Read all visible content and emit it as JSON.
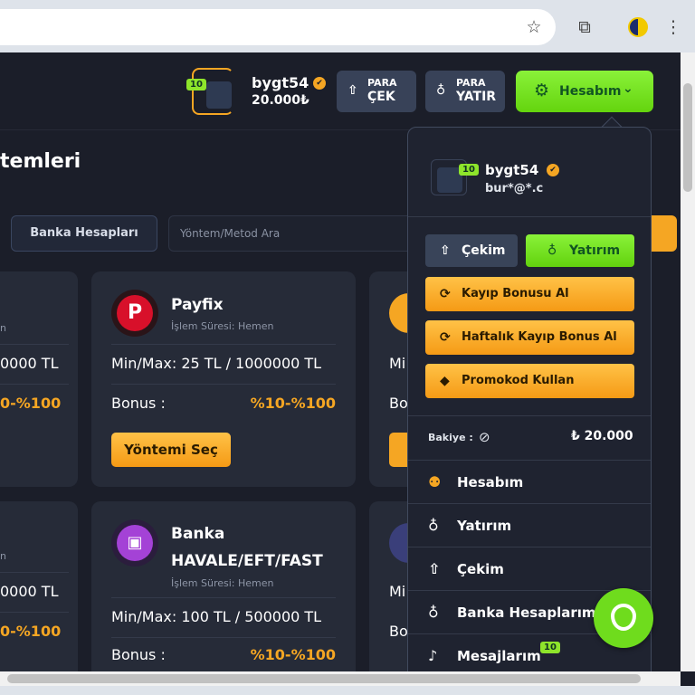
{
  "header": {
    "username": "bygt54",
    "balance": "20.000₺",
    "level": "10",
    "para_cek": {
      "line1": "PARA",
      "line2": "ÇEK"
    },
    "para_yatir": {
      "line1": "PARA",
      "line2": "YATIR"
    },
    "hesabim": "Hesabım"
  },
  "page": {
    "title": "temleri",
    "tab_bank": "Banka Hesapları",
    "search_placeholder": "Yöntem/Metod Ara"
  },
  "cards": {
    "payfix": {
      "name": "Payfix",
      "logo_letter": "P",
      "duration": "İşlem Süresi: Hemen",
      "minmax_label": "Min/Max:",
      "minmax_value": "25 TL / 1000000 TL",
      "bonus_label": "Bonus :",
      "bonus_value": "%10-%100",
      "select": "Yöntemi Seç"
    },
    "banka": {
      "name_line1": "Banka",
      "name_line2": "HAVALE/EFT/FAST",
      "duration": "İşlem Süresi: Hemen",
      "minmax_label": "Min/Max:",
      "minmax_value": "100 TL / 500000 TL",
      "bonus_label": "Bonus :",
      "bonus_value": "%10-%100"
    },
    "left_partial": {
      "sub1": "n",
      "max1": "0000 TL",
      "bonus1": "0-%100",
      "sub2": "n",
      "max2": "0000 TL",
      "bonus2": "0-%100"
    },
    "right_partial": {
      "mi": "Mi",
      "bo": "Bo"
    }
  },
  "dropdown": {
    "username": "bygt54",
    "email": "bur*@*.c",
    "level": "10",
    "cekim_btn": "Çekim",
    "yatirim_btn": "Yatırım",
    "kayip_bonusu": "Kayıp Bonusu Al",
    "haftalik_bonus": "Haftalık Kayıp Bonus Al",
    "promokod": "Promokod Kullan",
    "bakiye_label": "Bakiye :",
    "bakiye_value": "₺ 20.000",
    "menu": [
      {
        "label": "Hesabım",
        "icon": "user-gear-icon"
      },
      {
        "label": "Yatırım",
        "icon": "deposit-icon"
      },
      {
        "label": "Çekim",
        "icon": "withdraw-icon"
      },
      {
        "label": "Banka Hesaplarım",
        "icon": "bank-icon"
      },
      {
        "label": "Mesajlarım",
        "icon": "bell-icon",
        "badge": "10"
      }
    ]
  },
  "colors": {
    "accent_green": "#7be32a",
    "accent_orange": "#f5a623",
    "panel_bg": "#1f2330"
  }
}
